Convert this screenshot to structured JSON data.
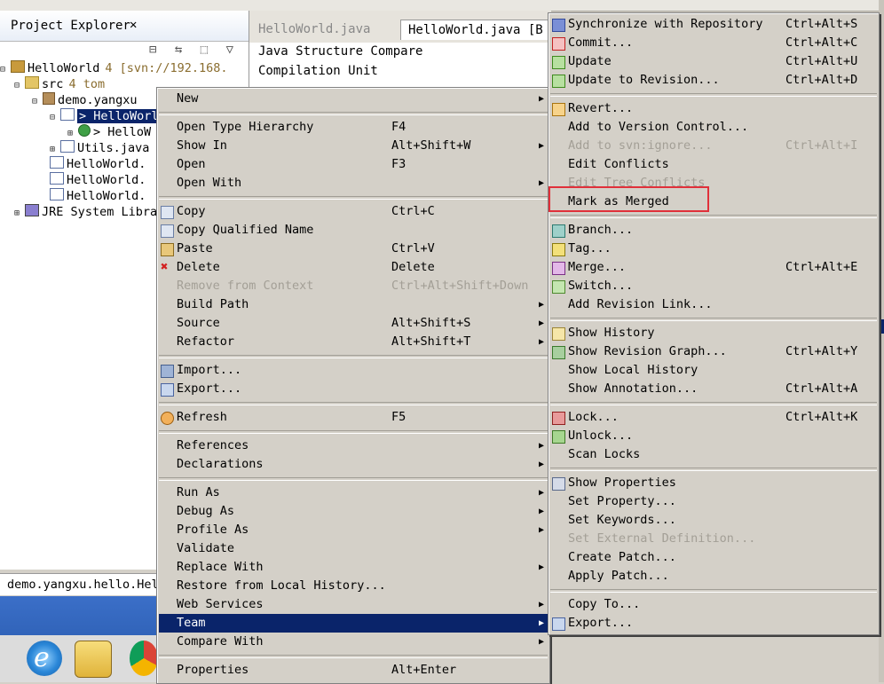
{
  "explorer": {
    "title": "Project Explorer",
    "close": "✕",
    "toolbar": "⊟ ⇆ ⬚ ▽",
    "tree": [
      {
        "text": "HelloWorld",
        "suffix": "4 [svn://192.168.",
        "icon": "project-icon"
      },
      {
        "text": "src",
        "suffix": "4 tom",
        "icon": "source-folder-icon"
      },
      {
        "text": "demo.yangxu",
        "suffix": "",
        "icon": "package-icon"
      },
      {
        "text": "> HelloWorl",
        "suffix": "",
        "icon": "java-file-icon"
      },
      {
        "text": "> HelloW",
        "suffix": "",
        "icon": "class-icon"
      },
      {
        "text": "Utils.java",
        "suffix": "",
        "icon": "java-file-icon"
      },
      {
        "text": "HelloWorld.",
        "suffix": "",
        "icon": "java-file-icon"
      },
      {
        "text": "HelloWorld.",
        "suffix": "",
        "icon": "java-file-icon"
      },
      {
        "text": "HelloWorld.",
        "suffix": "",
        "icon": "java-file-icon"
      },
      {
        "text": "JRE System Libra",
        "suffix": "",
        "icon": "library-icon"
      }
    ]
  },
  "editor": {
    "tab1": "HelloWorld.java",
    "tab2": "HelloWorld.java [B",
    "structure_title": "Java Structure Compare",
    "structure_row": "Compilation Unit"
  },
  "bottom": {
    "text": "demo.yangxu.hello.Hel"
  },
  "taskbar": {
    "ie_glyph": "e"
  },
  "context_menu": {
    "items": [
      {
        "label": "New",
        "accel": "",
        "submenu": true,
        "state": "normal",
        "icon": ""
      },
      {
        "sep": true
      },
      {
        "label": "Open Type Hierarchy",
        "accel": "F4",
        "submenu": false,
        "state": "normal",
        "icon": ""
      },
      {
        "label": "Show In",
        "accel": "Alt+Shift+W",
        "submenu": true,
        "state": "normal",
        "icon": ""
      },
      {
        "label": "Open",
        "accel": "F3",
        "submenu": false,
        "state": "normal",
        "icon": ""
      },
      {
        "label": "Open With",
        "accel": "",
        "submenu": true,
        "state": "normal",
        "icon": ""
      },
      {
        "sep": true
      },
      {
        "label": "Copy",
        "accel": "Ctrl+C",
        "submenu": false,
        "state": "normal",
        "icon": "copy-icon"
      },
      {
        "label": "Copy Qualified Name",
        "accel": "",
        "submenu": false,
        "state": "normal",
        "icon": "copy-icon"
      },
      {
        "label": "Paste",
        "accel": "Ctrl+V",
        "submenu": false,
        "state": "normal",
        "icon": "paste-icon"
      },
      {
        "label": "Delete",
        "accel": "Delete",
        "submenu": false,
        "state": "normal",
        "icon": "delete-icon"
      },
      {
        "label": "Remove from Context",
        "accel": "Ctrl+Alt+Shift+Down",
        "submenu": false,
        "state": "disabled",
        "icon": ""
      },
      {
        "label": "Build Path",
        "accel": "",
        "submenu": true,
        "state": "normal",
        "icon": ""
      },
      {
        "label": "Source",
        "accel": "Alt+Shift+S",
        "submenu": true,
        "state": "normal",
        "icon": ""
      },
      {
        "label": "Refactor",
        "accel": "Alt+Shift+T",
        "submenu": true,
        "state": "normal",
        "icon": ""
      },
      {
        "sep": true
      },
      {
        "label": "Import...",
        "accel": "",
        "submenu": false,
        "state": "normal",
        "icon": "import-icon"
      },
      {
        "label": "Export...",
        "accel": "",
        "submenu": false,
        "state": "normal",
        "icon": "export-icon"
      },
      {
        "sep": true
      },
      {
        "label": "Refresh",
        "accel": "F5",
        "submenu": false,
        "state": "normal",
        "icon": "refresh-icon"
      },
      {
        "sep": true
      },
      {
        "label": "References",
        "accel": "",
        "submenu": true,
        "state": "normal",
        "icon": ""
      },
      {
        "label": "Declarations",
        "accel": "",
        "submenu": true,
        "state": "normal",
        "icon": ""
      },
      {
        "sep": true
      },
      {
        "label": "Run As",
        "accel": "",
        "submenu": true,
        "state": "normal",
        "icon": ""
      },
      {
        "label": "Debug As",
        "accel": "",
        "submenu": true,
        "state": "normal",
        "icon": ""
      },
      {
        "label": "Profile As",
        "accel": "",
        "submenu": true,
        "state": "normal",
        "icon": ""
      },
      {
        "label": "Validate",
        "accel": "",
        "submenu": false,
        "state": "normal",
        "icon": ""
      },
      {
        "label": "Replace With",
        "accel": "",
        "submenu": true,
        "state": "normal",
        "icon": ""
      },
      {
        "label": "Restore from Local History...",
        "accel": "",
        "submenu": false,
        "state": "normal",
        "icon": ""
      },
      {
        "label": "Web Services",
        "accel": "",
        "submenu": true,
        "state": "normal",
        "icon": ""
      },
      {
        "label": "Team",
        "accel": "",
        "submenu": true,
        "state": "active",
        "icon": ""
      },
      {
        "label": "Compare With",
        "accel": "",
        "submenu": true,
        "state": "normal",
        "icon": ""
      },
      {
        "sep": true
      },
      {
        "label": "Properties",
        "accel": "Alt+Enter",
        "submenu": false,
        "state": "normal",
        "icon": ""
      }
    ]
  },
  "team_menu": {
    "items": [
      {
        "label": "Synchronize with Repository",
        "accel": "Ctrl+Alt+S",
        "state": "normal",
        "icon": "sync-icon"
      },
      {
        "label": "Commit...",
        "accel": "Ctrl+Alt+C",
        "state": "normal",
        "icon": "commit-icon"
      },
      {
        "label": "Update",
        "accel": "Ctrl+Alt+U",
        "state": "normal",
        "icon": "update-icon"
      },
      {
        "label": "Update to Revision...",
        "accel": "Ctrl+Alt+D",
        "state": "normal",
        "icon": "update-icon"
      },
      {
        "sep": true
      },
      {
        "label": "Revert...",
        "accel": "",
        "state": "normal",
        "icon": "revert-icon"
      },
      {
        "label": "Add to Version Control...",
        "accel": "",
        "state": "normal",
        "icon": ""
      },
      {
        "label": "Add to svn:ignore...",
        "accel": "Ctrl+Alt+I",
        "state": "disabled",
        "icon": ""
      },
      {
        "label": "Edit Conflicts",
        "accel": "",
        "state": "normal",
        "icon": ""
      },
      {
        "label": "Edit Tree Conflicts",
        "accel": "",
        "state": "disabled",
        "icon": ""
      },
      {
        "label": "Mark as Merged",
        "accel": "",
        "state": "normal",
        "icon": ""
      },
      {
        "sep": true
      },
      {
        "label": "Branch...",
        "accel": "",
        "state": "normal",
        "icon": "branch-icon"
      },
      {
        "label": "Tag...",
        "accel": "",
        "state": "normal",
        "icon": "tag-icon"
      },
      {
        "label": "Merge...",
        "accel": "Ctrl+Alt+E",
        "state": "normal",
        "icon": "merge-icon"
      },
      {
        "label": "Switch...",
        "accel": "",
        "state": "normal",
        "icon": "switch-icon"
      },
      {
        "label": "Add Revision Link...",
        "accel": "",
        "state": "normal",
        "icon": ""
      },
      {
        "sep": true
      },
      {
        "label": "Show History",
        "accel": "",
        "state": "normal",
        "icon": "history-icon"
      },
      {
        "label": "Show Revision Graph...",
        "accel": "Ctrl+Alt+Y",
        "state": "normal",
        "icon": "revision-graph-icon"
      },
      {
        "label": "Show Local History",
        "accel": "",
        "state": "normal",
        "icon": ""
      },
      {
        "label": "Show Annotation...",
        "accel": "Ctrl+Alt+A",
        "state": "normal",
        "icon": ""
      },
      {
        "sep": true
      },
      {
        "label": "Lock...",
        "accel": "Ctrl+Alt+K",
        "state": "normal",
        "icon": "lock-icon"
      },
      {
        "label": "Unlock...",
        "accel": "",
        "state": "normal",
        "icon": "unlock-icon"
      },
      {
        "label": "Scan Locks",
        "accel": "",
        "state": "normal",
        "icon": ""
      },
      {
        "sep": true
      },
      {
        "label": "Show Properties",
        "accel": "",
        "state": "normal",
        "icon": "properties-icon"
      },
      {
        "label": "Set Property...",
        "accel": "",
        "state": "normal",
        "icon": ""
      },
      {
        "label": "Set Keywords...",
        "accel": "",
        "state": "normal",
        "icon": ""
      },
      {
        "label": "Set External Definition...",
        "accel": "",
        "state": "disabled",
        "icon": ""
      },
      {
        "label": "Create Patch...",
        "accel": "",
        "state": "normal",
        "icon": ""
      },
      {
        "label": "Apply Patch...",
        "accel": "",
        "state": "normal",
        "icon": ""
      },
      {
        "sep": true
      },
      {
        "label": "Copy To...",
        "accel": "",
        "state": "normal",
        "icon": ""
      },
      {
        "label": "Export...",
        "accel": "",
        "state": "normal",
        "icon": "export-icon"
      }
    ]
  },
  "colors": {
    "highlight": "#0a246a",
    "callout": "#e0303a",
    "menu_bg": "#d4d0c8"
  }
}
